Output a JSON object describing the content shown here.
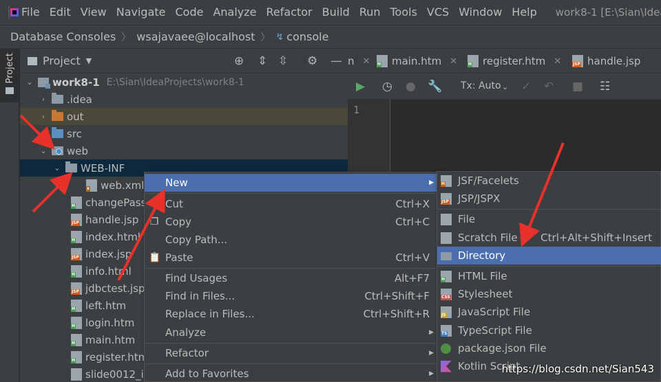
{
  "menubar": {
    "items": [
      "File",
      "Edit",
      "View",
      "Navigate",
      "Code",
      "Analyze",
      "Refactor",
      "Build",
      "Run",
      "Tools",
      "VCS",
      "Window",
      "Help"
    ],
    "window_title": "work8-1 [E:\\Sian\\Idea"
  },
  "breadcrumb": {
    "items": [
      "Database Consoles",
      "wsajavaee@localhost",
      "console"
    ]
  },
  "tool_stripe": {
    "project_tab": "Project"
  },
  "project_panel": {
    "title": "Project",
    "tree": [
      {
        "label": "work8-1",
        "path": "E:\\Sian\\IdeaProjects\\work8-1"
      },
      {
        "label": ".idea"
      },
      {
        "label": "out"
      },
      {
        "label": "src"
      },
      {
        "label": "web"
      },
      {
        "label": "WEB-INF"
      },
      {
        "label": "web.xml"
      },
      {
        "label": "changePass"
      },
      {
        "label": "handle.jsp"
      },
      {
        "label": "index.html"
      },
      {
        "label": "index.jsp"
      },
      {
        "label": "info.html"
      },
      {
        "label": "jdbctest.jsp"
      },
      {
        "label": "left.htm"
      },
      {
        "label": "login.htm"
      },
      {
        "label": "main.htm"
      },
      {
        "label": "register.htm"
      },
      {
        "label": "slide0012_i"
      }
    ]
  },
  "editor": {
    "tabs": [
      "main.htm",
      "register.htm",
      "handle.jsp"
    ],
    "partial_tab": "n",
    "toolbar": {
      "tx_label": "Tx: Auto"
    },
    "line_number": "1"
  },
  "context_menu": {
    "items": [
      {
        "label": "New",
        "shortcut": ""
      },
      {
        "label": "Cut",
        "shortcut": "Ctrl+X"
      },
      {
        "label": "Copy",
        "shortcut": "Ctrl+C"
      },
      {
        "label": "Copy Path...",
        "shortcut": ""
      },
      {
        "label": "Paste",
        "shortcut": "Ctrl+V"
      },
      {
        "label": "Find Usages",
        "shortcut": "Alt+F7"
      },
      {
        "label": "Find in Files...",
        "shortcut": "Ctrl+Shift+F"
      },
      {
        "label": "Replace in Files...",
        "shortcut": "Ctrl+Shift+R"
      },
      {
        "label": "Analyze",
        "shortcut": ""
      },
      {
        "label": "Refactor",
        "shortcut": ""
      },
      {
        "label": "Add to Favorites",
        "shortcut": ""
      }
    ]
  },
  "submenu": {
    "items": [
      {
        "label": "JSF/Facelets",
        "shortcut": ""
      },
      {
        "label": "JSP/JSPX",
        "shortcut": ""
      },
      {
        "label": "File",
        "shortcut": ""
      },
      {
        "label": "Scratch File",
        "shortcut": "Ctrl+Alt+Shift+Insert"
      },
      {
        "label": "Directory",
        "shortcut": ""
      },
      {
        "label": "HTML File",
        "shortcut": ""
      },
      {
        "label": "Stylesheet",
        "shortcut": ""
      },
      {
        "label": "JavaScript File",
        "shortcut": ""
      },
      {
        "label": "TypeScript File",
        "shortcut": ""
      },
      {
        "label": "package.json File",
        "shortcut": ""
      },
      {
        "label": "Kotlin Script",
        "shortcut": ""
      }
    ]
  },
  "watermark": "https://blog.csdn.net/Sian543",
  "colors": {
    "selection": "#4b6eaf",
    "tree_selected": "#0d293e",
    "annotation_arrow": "#e8312a"
  },
  "icons": {
    "toolbar": [
      "play-icon",
      "history-icon",
      "stop-icon",
      "wrench-icon",
      "check-icon",
      "undo-icon",
      "square-icon",
      "table-icon"
    ],
    "panel": [
      "crosshair-icon",
      "expand-all-icon",
      "collapse-all-icon",
      "gear-icon",
      "minimize-icon"
    ]
  }
}
